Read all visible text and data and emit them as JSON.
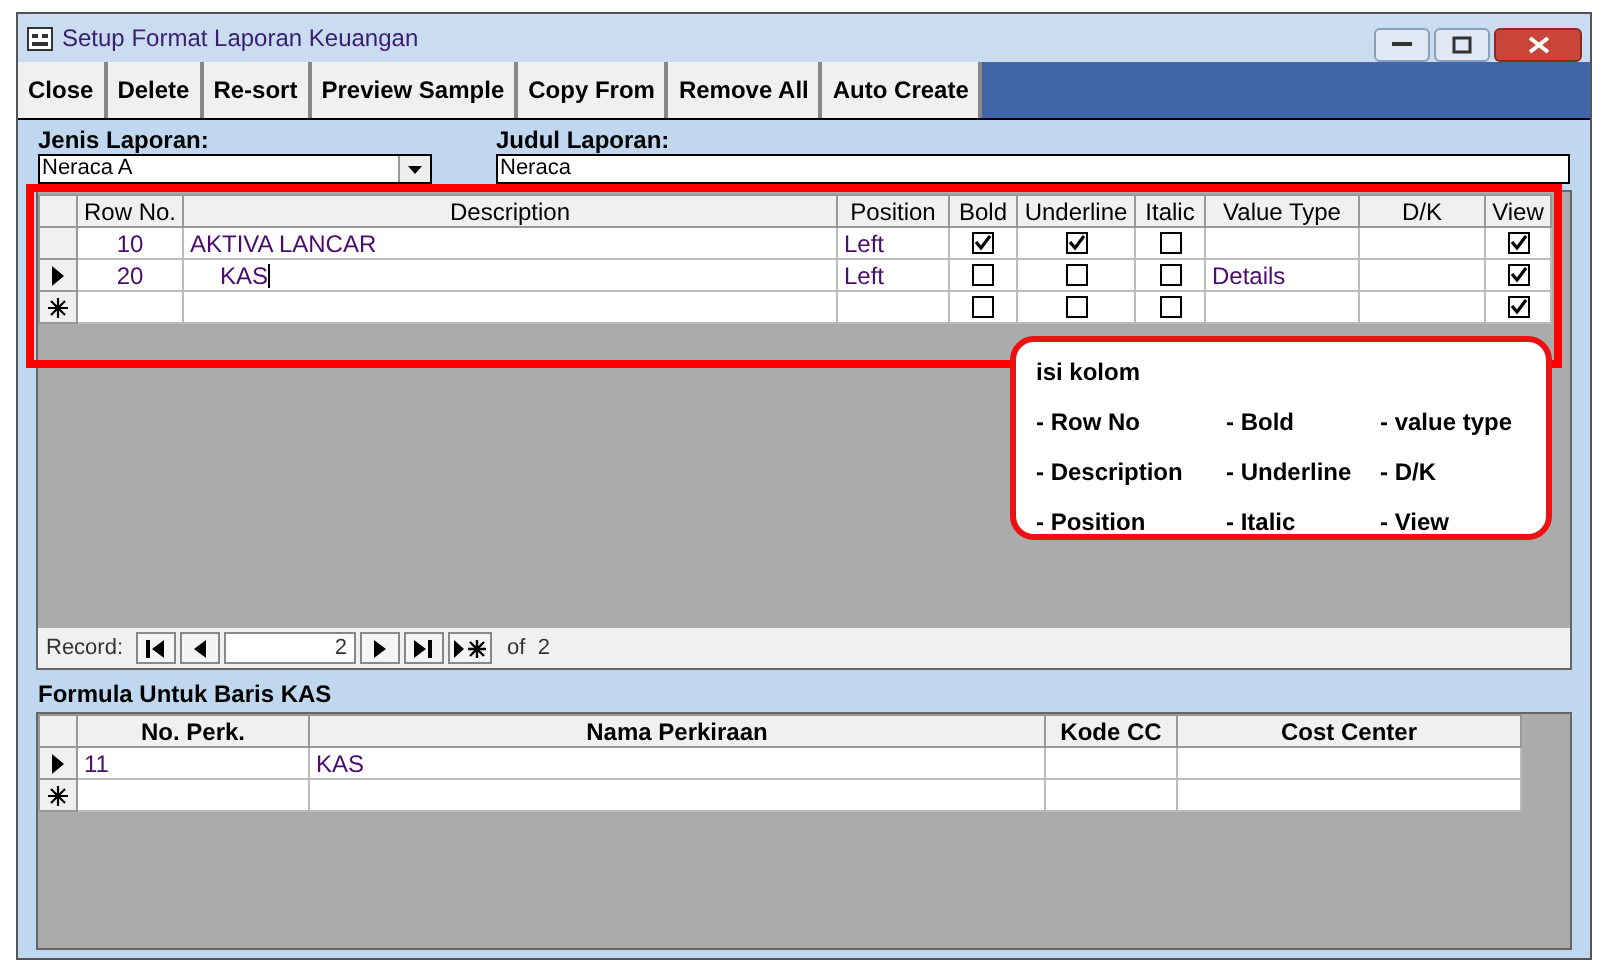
{
  "window": {
    "title": "Setup Format Laporan Keuangan"
  },
  "toolbar": [
    {
      "label": "Close"
    },
    {
      "label": "Delete"
    },
    {
      "label": "Re-sort"
    },
    {
      "label": "Preview Sample"
    },
    {
      "label": "Copy From"
    },
    {
      "label": "Remove All"
    },
    {
      "label": "Auto Create"
    }
  ],
  "jenis_laporan": {
    "label": "Jenis Laporan:",
    "value": "Neraca A"
  },
  "judul_laporan": {
    "label": "Judul Laporan:",
    "value": "Neraca"
  },
  "grid": {
    "columns": [
      "Row No.",
      "Description",
      "Position",
      "Bold",
      "Underline",
      "Italic",
      "Value Type",
      "D/K",
      "View"
    ],
    "rows": [
      {
        "kind": "record",
        "current": false,
        "row_no": "10",
        "description": "AKTIVA LANCAR",
        "indented": false,
        "editing": false,
        "position": "Left",
        "bold": true,
        "underline": true,
        "italic": false,
        "value_type": "",
        "dk": "",
        "view": true
      },
      {
        "kind": "record",
        "current": true,
        "row_no": "20",
        "description": "KAS",
        "indented": true,
        "editing": true,
        "position": "Left",
        "bold": false,
        "underline": false,
        "italic": false,
        "value_type": "Details",
        "dk": "",
        "view": true
      },
      {
        "kind": "new",
        "bold": false,
        "underline": false,
        "italic": false,
        "view": true
      }
    ]
  },
  "callout": {
    "title": "isi kolom",
    "items": [
      "- Row No",
      "- Bold",
      "- value type",
      "- Description",
      "- Underline",
      "- D/K",
      "- Position",
      "- Italic",
      "- View"
    ]
  },
  "record_nav": {
    "label": "Record:",
    "value": "2",
    "of": "of  2"
  },
  "formula": {
    "title": "Formula Untuk Baris KAS",
    "columns": [
      "No. Perk.",
      "Nama Perkiraan",
      "Kode CC",
      "Cost Center"
    ],
    "rows": [
      {
        "kind": "record",
        "current": true,
        "cells": [
          "11",
          "KAS",
          "",
          ""
        ]
      },
      {
        "kind": "new",
        "cells": [
          "",
          "",
          "",
          ""
        ]
      }
    ]
  }
}
